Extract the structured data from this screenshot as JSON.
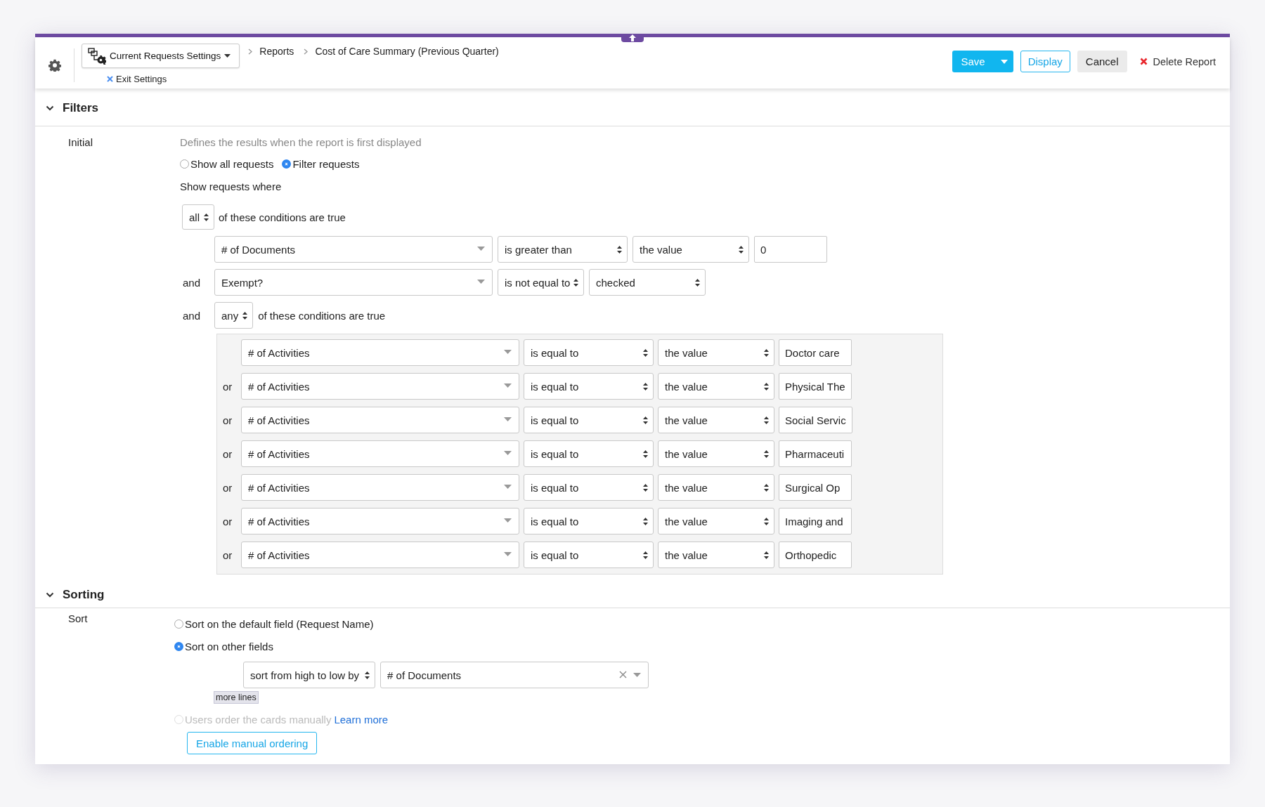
{
  "header": {
    "settings_menu": "Current Requests Settings",
    "exit_settings": "Exit Settings",
    "breadcrumbs": [
      "Reports",
      "Cost of Care Summary (Previous Quarter)"
    ],
    "save": "Save",
    "display": "Display",
    "cancel": "Cancel",
    "delete": "Delete Report"
  },
  "filters": {
    "title": "Filters",
    "expanded": true,
    "label": "Initial",
    "description": "Defines the results when the report is first displayed",
    "mode_options": [
      {
        "label": "Show all requests",
        "selected": false
      },
      {
        "label": "Filter requests",
        "selected": true
      }
    ],
    "show_where": "Show requests where",
    "match": "all",
    "match_suffix": "of these conditions are true",
    "conditions": [
      {
        "kind": "condition",
        "field": "# of Documents",
        "operator": "is greater than",
        "compare": "the value",
        "value": "0"
      },
      {
        "kind": "condition",
        "connector": "and",
        "field": "Exempt?",
        "operator": "is not equal to",
        "compare": "checked"
      },
      {
        "kind": "group",
        "connector": "and",
        "match": "any",
        "suffix": "of these conditions are true",
        "conditions": [
          {
            "field": "# of Activities",
            "operator": "is equal to",
            "compare": "the value",
            "value": "Doctor care"
          },
          {
            "connector": "or",
            "field": "# of Activities",
            "operator": "is equal to",
            "compare": "the value",
            "value": "Physical The"
          },
          {
            "connector": "or",
            "field": "# of Activities",
            "operator": "is equal to",
            "compare": "the value",
            "value": "Social Servic"
          },
          {
            "connector": "or",
            "field": "# of Activities",
            "operator": "is equal to",
            "compare": "the value",
            "value": "Pharmaceuti"
          },
          {
            "connector": "or",
            "field": "# of Activities",
            "operator": "is equal to",
            "compare": "the value",
            "value": "Surgical Op"
          },
          {
            "connector": "or",
            "field": "# of Activities",
            "operator": "is equal to",
            "compare": "the value",
            "value": "Imaging and"
          },
          {
            "connector": "or",
            "field": "# of Activities",
            "operator": "is equal to",
            "compare": "the value",
            "value": "Orthopedic"
          }
        ]
      }
    ]
  },
  "sorting": {
    "title": "Sorting",
    "expanded": true,
    "label": "Sort",
    "options": [
      {
        "label": "Sort on the default field (Request Name)",
        "selected": false,
        "disabled": false
      },
      {
        "label": "Sort on other fields",
        "selected": true,
        "disabled": false
      }
    ],
    "direction": "sort from high to low by",
    "sort_field": "# of Documents",
    "more_lines": "more lines",
    "manual_option": {
      "label": "Users order the cards manually",
      "selected": false,
      "disabled": true,
      "link": "Learn more"
    },
    "enable_button": "Enable manual ordering"
  }
}
